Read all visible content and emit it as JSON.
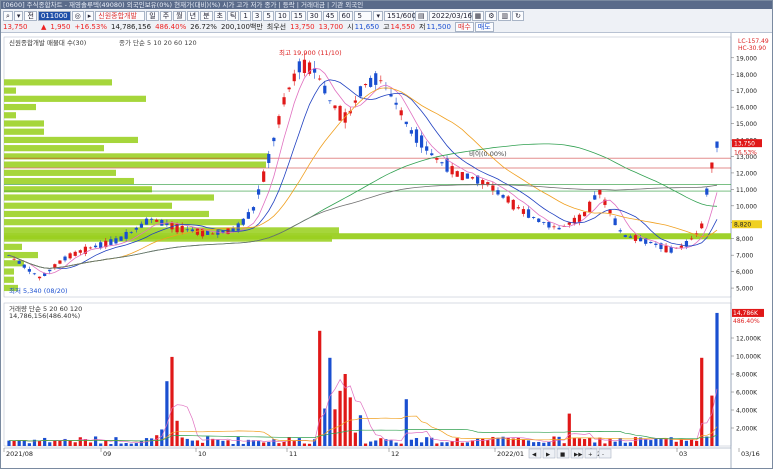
{
  "window": {
    "title": "[0600] 주식종합차트 - 재영솔루텍(49080) 외국인보유(0%) 현재가(대비)(%) 시가 고가 저가 종가 | 등락 | 거래대금 | 기관 외국인"
  },
  "toolbar": {
    "row1": {
      "code": "011000",
      "stock_name": "신원종합개발",
      "period_buttons": [
        "주",
        "월",
        "년",
        "분",
        "초",
        "틱"
      ],
      "number_buttons": [
        "1",
        "3",
        "5",
        "10",
        "15",
        "30",
        "45",
        "60"
      ],
      "count_field": "5",
      "range_field": "151/600",
      "date_field": "2022/03/16",
      "tool_icons": [
        "settings-icon",
        "grid-icon",
        "sync-icon"
      ]
    },
    "row2": {
      "price": "13,750",
      "change": "1,950",
      "change_pct": "+16.53%",
      "volume": "14,786,156",
      "volume_pct": "486.40%",
      "ratio": "26.72%",
      "value_label": "200,100백만",
      "basis": "최우선",
      "values": [
        "13,750",
        "13,700"
      ],
      "ohlc_labels": [
        "시",
        "고",
        "저"
      ],
      "ohlc": [
        "11,650",
        "14,550",
        "11,500"
      ],
      "buy_label": "매수",
      "sell_label": "매도"
    }
  },
  "price_panel": {
    "legend": "신원종합개발 매물대 수(30)",
    "ma_legend": "종가 단순 5 10 20 60 120",
    "max_label": "최고 19,900 (11/10)",
    "min_label": "최저 5,340 (08/20)",
    "mid_label": "비이(0.00%)",
    "corner_labels": [
      "LC-157.49",
      "HC-30.90"
    ],
    "axis_ticks": [
      "19,000",
      "18,000",
      "17,000",
      "16,000",
      "15,000",
      "14,000",
      "13,000",
      "12,000",
      "11,000",
      "10,000",
      "9,000",
      "8,000",
      "7,000",
      "6,000",
      "5,000"
    ],
    "price_tag": "13,750",
    "pct_tag": "16.53%",
    "ma_tag": "8,820"
  },
  "volume_panel": {
    "legend": "거래량 단순 5 20 60 120",
    "value_label": "14,786,156(486.40%)",
    "axis_ticks": [
      "12,000K",
      "10,000K",
      "8,000K",
      "6,000K",
      "4,000K",
      "2,000K"
    ],
    "volume_tag": "14,786K",
    "pct_tag": "486.40%"
  },
  "x_axis": {
    "labels": [
      "2021/08",
      "09",
      "10",
      "11",
      "12",
      "2022/01",
      "02",
      "03",
      "03/16"
    ]
  },
  "nav_buttons": [
    "◀",
    "▶",
    "■",
    "▶▶",
    "+",
    "-"
  ],
  "colors": {
    "up": "#e01818",
    "down": "#1a4fd0",
    "ma5": "#e070c0",
    "ma10": "#2040c0",
    "ma20": "#f0a020",
    "ma60": "#30a050",
    "ma120": "#707070",
    "volume_profile": "#9ad020"
  }
}
